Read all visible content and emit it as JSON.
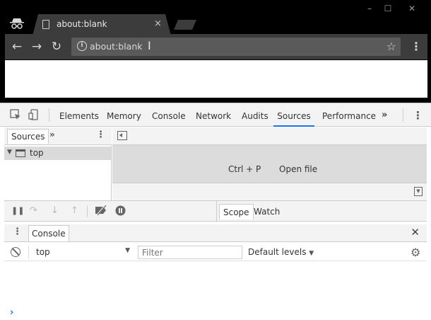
{
  "browser": {
    "tab_title": "about:blank",
    "tab_close": "×",
    "url": "about:blank",
    "window_controls": [
      "–",
      "☐",
      "✕"
    ]
  },
  "devtools": {
    "panel_tabs": [
      "Elements",
      "Memory",
      "Console",
      "Network",
      "Audits",
      "Sources",
      "Performance"
    ],
    "active_panel": "Sources",
    "accent_color": "#1a73e8",
    "more_tabs": "»",
    "navigator": {
      "tab_label": "Sources",
      "more": "»",
      "tree_item": "top"
    },
    "editor": {
      "shortcut": "Ctrl + P",
      "shortcut_label": "Open file"
    },
    "sidebar_tabs": [
      "Scope",
      "Watch"
    ],
    "drawer": {
      "tab_label": "Console",
      "close": "✕",
      "context": "top",
      "filter_placeholder": "Filter",
      "levels": "Default levels",
      "prompt": "›"
    }
  }
}
